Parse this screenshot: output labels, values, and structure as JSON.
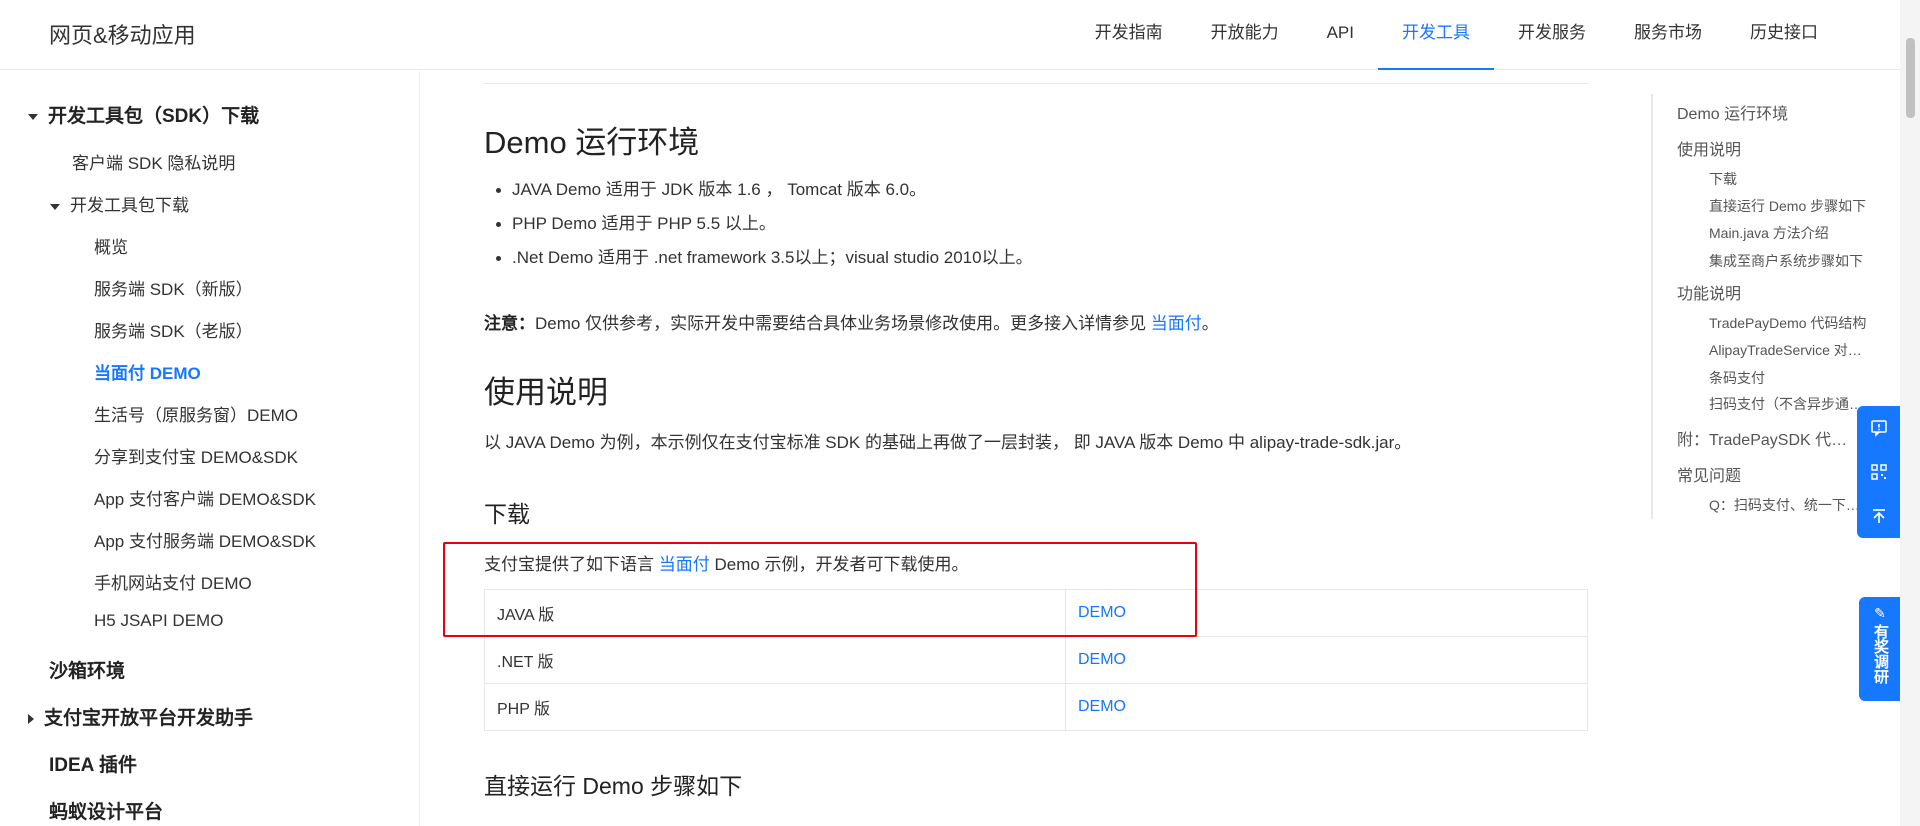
{
  "header": {
    "brand": "网页&移动应用",
    "nav": [
      {
        "label": "开发指南"
      },
      {
        "label": "开放能力"
      },
      {
        "label": "API"
      },
      {
        "label": "开发工具",
        "active": true
      },
      {
        "label": "开发服务"
      },
      {
        "label": "服务市场"
      },
      {
        "label": "历史接口"
      }
    ]
  },
  "sidebar": {
    "items": [
      {
        "label": "开发工具包（SDK）下载"
      },
      {
        "label": "客户端 SDK 隐私说明"
      },
      {
        "label": "开发工具包下载"
      },
      {
        "label": "概览"
      },
      {
        "label": "服务端 SDK（新版）"
      },
      {
        "label": "服务端 SDK（老版）"
      },
      {
        "label": "当面付 DEMO"
      },
      {
        "label": "生活号（原服务窗）DEMO"
      },
      {
        "label": "分享到支付宝 DEMO&SDK"
      },
      {
        "label": "App 支付客户端 DEMO&SDK"
      },
      {
        "label": "App 支付服务端 DEMO&SDK"
      },
      {
        "label": "手机网站支付 DEMO"
      },
      {
        "label": "H5 JSAPI DEMO"
      },
      {
        "label": "沙箱环境"
      },
      {
        "label": "支付宝开放平台开发助手"
      },
      {
        "label": "IDEA 插件"
      },
      {
        "label": "蚂蚁设计平台"
      }
    ]
  },
  "main": {
    "env_title": "Demo 运行环境",
    "bullets": [
      "JAVA Demo 适用于 JDK 版本 1.6 ， Tomcat 版本 6.0。",
      "PHP Demo 适用于 PHP 5.5 以上。",
      ".Net Demo 适用于 .net framework 3.5以上；visual studio 2010以上。"
    ],
    "note_label": "注意：",
    "note_text": "Demo 仅供参考，实际开发中需要结合具体业务场景修改使用。更多接入详情参见 ",
    "note_link": "当面付",
    "note_end": "。",
    "usage_title": "使用说明",
    "usage_text": "以 JAVA Demo 为例，本示例仅在支付宝标准 SDK 的基础上再做了一层封装， 即 JAVA 版本 Demo 中 alipay-trade-sdk.jar。",
    "download_title": "下载",
    "download_text_pre": "支付宝提供了如下语言 ",
    "download_link": "当面付",
    "download_text_post": " Demo 示例，开发者可下载使用。",
    "table": [
      {
        "lang": "JAVA 版",
        "link": "DEMO"
      },
      {
        "lang": ".NET 版",
        "link": "DEMO"
      },
      {
        "lang": "PHP 版",
        "link": "DEMO"
      }
    ],
    "run_title": "直接运行 Demo 步骤如下"
  },
  "toc": {
    "items": [
      {
        "label": "Demo 运行环境"
      },
      {
        "label": "使用说明"
      },
      {
        "label": "下载"
      },
      {
        "label": "直接运行 Demo 步骤如下"
      },
      {
        "label": "Main.java 方法介绍"
      },
      {
        "label": "集成至商户系统步骤如下"
      },
      {
        "label": "功能说明"
      },
      {
        "label": "TradePayDemo 代码结构"
      },
      {
        "label": "AlipayTradeService 对…"
      },
      {
        "label": "条码支付"
      },
      {
        "label": "扫码支付（不含异步通…"
      },
      {
        "label": "附：TradePaySDK 代…"
      },
      {
        "label": "常见问题"
      },
      {
        "label": "Q：扫码支付、统一下…"
      }
    ]
  },
  "floating": {
    "icons": [
      "feedback-icon",
      "qrcode-icon",
      "back-to-top-icon"
    ],
    "survey_label": "有奖调研"
  },
  "colors": {
    "accent": "#1677ff",
    "highlight_box": "#e60012"
  }
}
